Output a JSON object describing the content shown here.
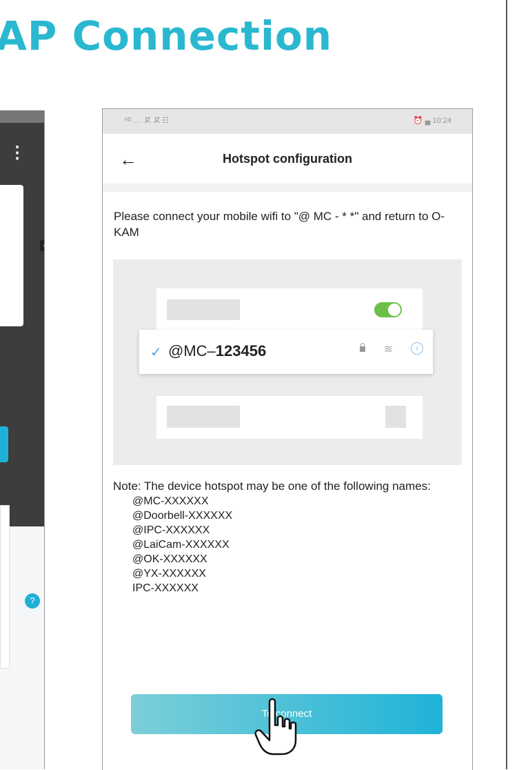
{
  "page": {
    "title": "AP Connection"
  },
  "status_bar": {
    "left": "ᴴᴰ … .ⴽ .ⴽ ☷",
    "right": "⏰ ▄ 10:24"
  },
  "app_bar": {
    "back_icon": "back-arrow-icon",
    "title": "Hotspot configuration"
  },
  "instruction": "Please connect your mobile wifi to \"@ MC - * *\" and return to O-KAM",
  "illustration": {
    "ssid_prefix": "@MC–",
    "ssid_bold": "123456",
    "check": "✓",
    "info": "i",
    "toggle_color": "#6cc04a",
    "check_color": "#4aa3e8"
  },
  "note": {
    "text": "Note: The device hotspot may be one of the following names:",
    "names": [
      "@MC-XXXXXX",
      "@Doorbell-XXXXXX",
      "@IPC-XXXXXX",
      "@LaiCam-XXXXXX",
      "@OK-XXXXXX",
      "@YX-XXXXXX",
      "IPC-XXXXXX"
    ]
  },
  "connect_button": {
    "label": "To connect"
  },
  "left_phone": {
    "popup_badge": "e",
    "help_icon": "?"
  },
  "colors": {
    "accent": "#2ab8d0",
    "button_start": "#7ccfd8",
    "button_end": "#1fb3d8"
  }
}
